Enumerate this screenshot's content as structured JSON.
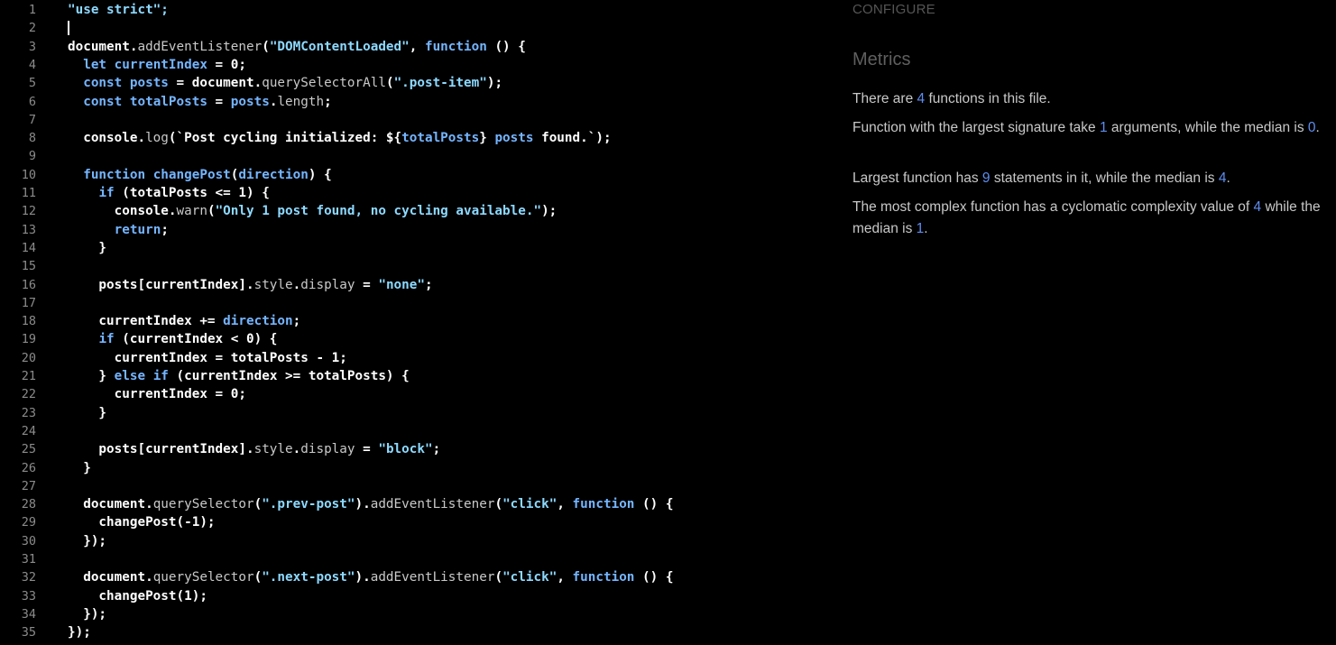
{
  "editor": {
    "lines": [
      [
        {
          "t": "\"use strict\";",
          "c": "str"
        }
      ],
      [
        {
          "t": "",
          "c": "cursor"
        }
      ],
      [
        {
          "t": "document.",
          "c": "plain"
        },
        {
          "t": "addEventListener",
          "c": "prop"
        },
        {
          "t": "(",
          "c": "plain"
        },
        {
          "t": "\"DOMContentLoaded\"",
          "c": "str"
        },
        {
          "t": ", ",
          "c": "plain"
        },
        {
          "t": "function",
          "c": "kw"
        },
        {
          "t": " () {",
          "c": "plain"
        }
      ],
      [
        {
          "t": "  ",
          "c": "plain"
        },
        {
          "t": "let",
          "c": "kw"
        },
        {
          "t": " ",
          "c": "plain"
        },
        {
          "t": "currentIndex",
          "c": "kw"
        },
        {
          "t": " = 0;",
          "c": "plain"
        }
      ],
      [
        {
          "t": "  ",
          "c": "plain"
        },
        {
          "t": "const",
          "c": "kw"
        },
        {
          "t": " ",
          "c": "plain"
        },
        {
          "t": "posts",
          "c": "kw"
        },
        {
          "t": " = document.",
          "c": "plain"
        },
        {
          "t": "querySelectorAll",
          "c": "prop"
        },
        {
          "t": "(",
          "c": "plain"
        },
        {
          "t": "\".post-item\"",
          "c": "str"
        },
        {
          "t": ");",
          "c": "plain"
        }
      ],
      [
        {
          "t": "  ",
          "c": "plain"
        },
        {
          "t": "const",
          "c": "kw"
        },
        {
          "t": " ",
          "c": "plain"
        },
        {
          "t": "totalPosts",
          "c": "kw"
        },
        {
          "t": " = ",
          "c": "plain"
        },
        {
          "t": "posts",
          "c": "kw"
        },
        {
          "t": ".",
          "c": "plain"
        },
        {
          "t": "length",
          "c": "prop"
        },
        {
          "t": ";",
          "c": "plain"
        }
      ],
      [],
      [
        {
          "t": "  console.",
          "c": "plain"
        },
        {
          "t": "log",
          "c": "prop"
        },
        {
          "t": "(`Post cycling initialized: ${",
          "c": "plain"
        },
        {
          "t": "totalPosts",
          "c": "kw"
        },
        {
          "t": "} ",
          "c": "plain"
        },
        {
          "t": "posts",
          "c": "kw"
        },
        {
          "t": " found.`);",
          "c": "plain"
        }
      ],
      [],
      [
        {
          "t": "  ",
          "c": "plain"
        },
        {
          "t": "function",
          "c": "kw"
        },
        {
          "t": " ",
          "c": "plain"
        },
        {
          "t": "changePost",
          "c": "kw"
        },
        {
          "t": "(",
          "c": "plain"
        },
        {
          "t": "direction",
          "c": "kw"
        },
        {
          "t": ") {",
          "c": "plain"
        }
      ],
      [
        {
          "t": "    ",
          "c": "plain"
        },
        {
          "t": "if",
          "c": "kw"
        },
        {
          "t": " (totalPosts <= 1) {",
          "c": "plain"
        }
      ],
      [
        {
          "t": "      console.",
          "c": "plain"
        },
        {
          "t": "warn",
          "c": "prop"
        },
        {
          "t": "(",
          "c": "plain"
        },
        {
          "t": "\"Only 1 post found, no cycling available.\"",
          "c": "str"
        },
        {
          "t": ");",
          "c": "plain"
        }
      ],
      [
        {
          "t": "      ",
          "c": "plain"
        },
        {
          "t": "return",
          "c": "kw"
        },
        {
          "t": ";",
          "c": "plain"
        }
      ],
      [
        {
          "t": "    }",
          "c": "plain"
        }
      ],
      [],
      [
        {
          "t": "    posts[currentIndex].",
          "c": "plain"
        },
        {
          "t": "style",
          "c": "prop"
        },
        {
          "t": ".",
          "c": "plain"
        },
        {
          "t": "display",
          "c": "prop"
        },
        {
          "t": " = ",
          "c": "plain"
        },
        {
          "t": "\"none\"",
          "c": "str"
        },
        {
          "t": ";",
          "c": "plain"
        }
      ],
      [],
      [
        {
          "t": "    currentIndex += ",
          "c": "plain"
        },
        {
          "t": "direction",
          "c": "kw"
        },
        {
          "t": ";",
          "c": "plain"
        }
      ],
      [
        {
          "t": "    ",
          "c": "plain"
        },
        {
          "t": "if",
          "c": "kw"
        },
        {
          "t": " (currentIndex < 0) {",
          "c": "plain"
        }
      ],
      [
        {
          "t": "      currentIndex = totalPosts - 1;",
          "c": "plain"
        }
      ],
      [
        {
          "t": "    } ",
          "c": "plain"
        },
        {
          "t": "else if",
          "c": "kw"
        },
        {
          "t": " (currentIndex >= totalPosts) {",
          "c": "plain"
        }
      ],
      [
        {
          "t": "      currentIndex = 0;",
          "c": "plain"
        }
      ],
      [
        {
          "t": "    }",
          "c": "plain"
        }
      ],
      [],
      [
        {
          "t": "    posts[currentIndex].",
          "c": "plain"
        },
        {
          "t": "style",
          "c": "prop"
        },
        {
          "t": ".",
          "c": "plain"
        },
        {
          "t": "display",
          "c": "prop"
        },
        {
          "t": " = ",
          "c": "plain"
        },
        {
          "t": "\"block\"",
          "c": "str"
        },
        {
          "t": ";",
          "c": "plain"
        }
      ],
      [
        {
          "t": "  }",
          "c": "plain"
        }
      ],
      [],
      [
        {
          "t": "  document.",
          "c": "plain"
        },
        {
          "t": "querySelector",
          "c": "prop"
        },
        {
          "t": "(",
          "c": "plain"
        },
        {
          "t": "\".prev-post\"",
          "c": "str"
        },
        {
          "t": ").",
          "c": "plain"
        },
        {
          "t": "addEventListener",
          "c": "prop"
        },
        {
          "t": "(",
          "c": "plain"
        },
        {
          "t": "\"click\"",
          "c": "str"
        },
        {
          "t": ", ",
          "c": "plain"
        },
        {
          "t": "function",
          "c": "kw"
        },
        {
          "t": " () {",
          "c": "plain"
        }
      ],
      [
        {
          "t": "    changePost(-1);",
          "c": "plain"
        }
      ],
      [
        {
          "t": "  });",
          "c": "plain"
        }
      ],
      [],
      [
        {
          "t": "  document.",
          "c": "plain"
        },
        {
          "t": "querySelector",
          "c": "prop"
        },
        {
          "t": "(",
          "c": "plain"
        },
        {
          "t": "\".next-post\"",
          "c": "str"
        },
        {
          "t": ").",
          "c": "plain"
        },
        {
          "t": "addEventListener",
          "c": "prop"
        },
        {
          "t": "(",
          "c": "plain"
        },
        {
          "t": "\"click\"",
          "c": "str"
        },
        {
          "t": ", ",
          "c": "plain"
        },
        {
          "t": "function",
          "c": "kw"
        },
        {
          "t": " () {",
          "c": "plain"
        }
      ],
      [
        {
          "t": "    changePost(1);",
          "c": "plain"
        }
      ],
      [
        {
          "t": "  });",
          "c": "plain"
        }
      ],
      [
        {
          "t": "});",
          "c": "plain"
        }
      ]
    ]
  },
  "panel": {
    "configure_label": "CONFIGURE",
    "metrics_title": "Metrics",
    "metrics": [
      [
        {
          "t": "There are "
        },
        {
          "t": "4",
          "n": true
        },
        {
          "t": " functions in this file."
        }
      ],
      [
        {
          "t": "Function with the largest signature take "
        },
        {
          "t": "1",
          "n": true
        },
        {
          "t": " arguments, while the median is "
        },
        {
          "t": "0",
          "n": true
        },
        {
          "t": "."
        }
      ],
      [
        {
          "t": "Largest function has "
        },
        {
          "t": "9",
          "n": true
        },
        {
          "t": " statements in it, while the median is "
        },
        {
          "t": "4",
          "n": true
        },
        {
          "t": "."
        }
      ],
      [
        {
          "t": "The most complex function has a cyclomatic complexity value of "
        },
        {
          "t": "4",
          "n": true
        },
        {
          "t": " while the median is "
        },
        {
          "t": "1",
          "n": true
        },
        {
          "t": "."
        }
      ]
    ]
  },
  "colors": {
    "background": "#000000",
    "line_number": "#8b8b8b",
    "string": "#8dd9ff",
    "keyword": "#75b5ff",
    "metric_number": "#5e8df0"
  }
}
